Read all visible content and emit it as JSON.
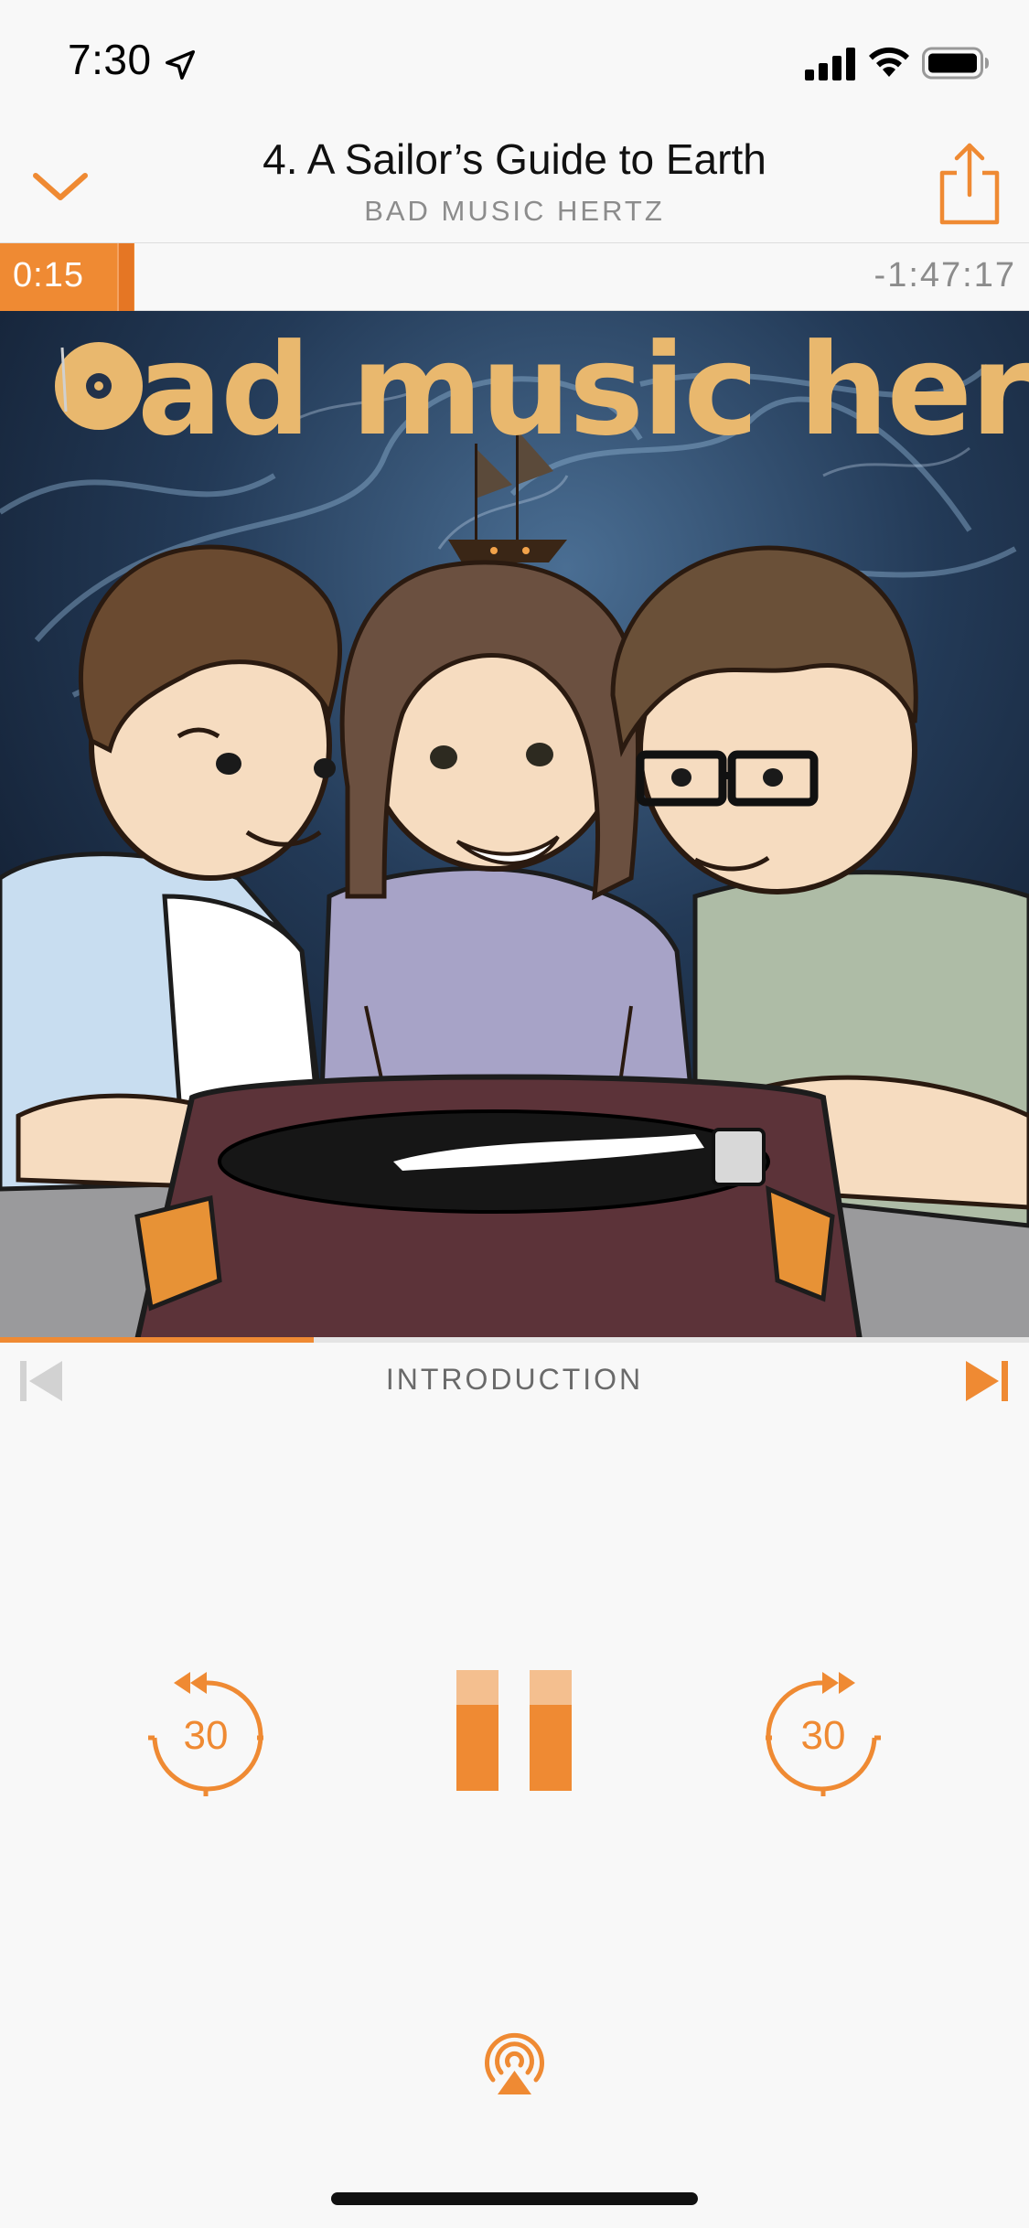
{
  "status_bar": {
    "time": "7:30",
    "icons": [
      "location-arrow-icon",
      "cellular-signal-icon",
      "wifi-icon",
      "battery-icon"
    ]
  },
  "header": {
    "episode_title": "4. A Sailor’s Guide to Earth",
    "podcast_name": "BAD MUSIC HERTZ",
    "dismiss_icon": "chevron-down-icon",
    "share_icon": "share-icon"
  },
  "scrubber": {
    "elapsed": "0:15",
    "remaining": "-1:47:17"
  },
  "artwork": {
    "logo_text": "ad music hertz",
    "logo_icon": "vinyl-record-icon",
    "description_hidden": false
  },
  "chapter": {
    "name": "INTRODUCTION",
    "progress": 0.305,
    "prev_icon": "previous-chapter-icon",
    "next_icon": "next-chapter-icon"
  },
  "controls": {
    "skip_back_seconds": "30",
    "skip_forward_seconds": "30",
    "play_state_icon": "pause-icon",
    "airplay_icon": "airplay-icon"
  },
  "colors": {
    "accent": "#ef8a33",
    "background": "#f8f8f8",
    "secondary_text": "#8c8c8c"
  }
}
